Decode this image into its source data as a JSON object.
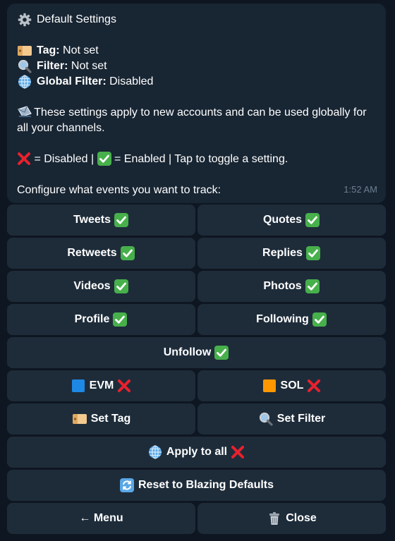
{
  "message": {
    "title": "Default Settings",
    "tag_label": "Tag:",
    "tag_value": "Not set",
    "filter_label": "Filter:",
    "filter_value": "Not set",
    "global_filter_label": "Global Filter:",
    "global_filter_value": "Disabled",
    "info_text": "These settings apply to new accounts and can be used globally for all your channels.",
    "legend_disabled": "= Disabled |",
    "legend_enabled": "= Enabled | Tap to toggle a setting.",
    "configure_text": "Configure what events you want to track:",
    "time": "1:52 AM"
  },
  "buttons": {
    "tweets": "Tweets",
    "quotes": "Quotes",
    "retweets": "Retweets",
    "replies": "Replies",
    "videos": "Videos",
    "photos": "Photos",
    "profile": "Profile",
    "following": "Following",
    "unfollow": "Unfollow",
    "evm": "EVM",
    "sol": "SOL",
    "set_tag": "Set Tag",
    "set_filter": "Set Filter",
    "apply_all": "Apply to all",
    "reset": "Reset to Blazing Defaults",
    "menu": "← Menu",
    "close": "Close"
  },
  "toggles": {
    "tweets": "enabled",
    "quotes": "enabled",
    "retweets": "enabled",
    "replies": "enabled",
    "videos": "enabled",
    "photos": "enabled",
    "profile": "enabled",
    "following": "enabled",
    "unfollow": "enabled",
    "evm": "disabled",
    "sol": "disabled",
    "apply_all": "disabled"
  },
  "icons": {
    "title": "gear-icon",
    "tag": "tag-icon",
    "filter": "magnifier-icon",
    "global_filter": "globe-icon",
    "info": "envelope-icon",
    "enabled": "check-mark-icon",
    "disabled": "cross-mark-icon",
    "evm": "blue-square-icon",
    "sol": "orange-square-icon",
    "reset": "refresh-icon",
    "close": "trash-icon"
  },
  "colors": {
    "background": "#0e1621",
    "message_bg": "#182533",
    "button_bg": "#1e2c3a",
    "enabled_green": "#47b04b",
    "disabled_red": "#e8212e",
    "evm_blue": "#1e88e5",
    "sol_orange": "#ff9800",
    "timestamp": "#6d7f8f"
  }
}
